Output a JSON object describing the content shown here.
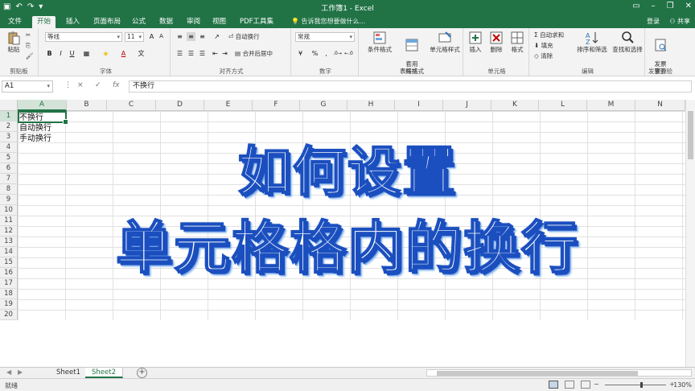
{
  "window": {
    "title": "工作簿1 - Excel",
    "login_label": "登录",
    "share_label": "共享"
  },
  "ribbon_tabs": [
    {
      "label": "文件"
    },
    {
      "label": "开始"
    },
    {
      "label": "插入"
    },
    {
      "label": "页面布局"
    },
    {
      "label": "公式"
    },
    {
      "label": "数据"
    },
    {
      "label": "审阅"
    },
    {
      "label": "视图"
    },
    {
      "label": "PDF工具集"
    }
  ],
  "tell_me": "告诉我您想要做什么...",
  "ribbon": {
    "clipboard": {
      "name": "剪贴板",
      "paste": "粘贴"
    },
    "font": {
      "name": "字体",
      "font_name": "等线",
      "font_size": "11",
      "bold": "B",
      "italic": "I",
      "underline": "U",
      "color_a": "A"
    },
    "alignment": {
      "name": "对齐方式",
      "wrap": "自动换行",
      "merge": "合并后居中"
    },
    "number": {
      "name": "数字",
      "format": "常规",
      "percent": "%",
      "comma": ","
    },
    "styles": {
      "name": "样式",
      "conditional": "条件格式",
      "table": "套用\n表格格式",
      "cell_styles": "单元格样式"
    },
    "cells": {
      "name": "单元格",
      "insert": "插入",
      "delete": "删除",
      "format": "格式"
    },
    "editing": {
      "name": "编辑",
      "autosum": "自动求和",
      "fill": "填充",
      "clear": "清除",
      "sort": "排序和筛选",
      "find": "查找和选择"
    },
    "send": {
      "name": "发票查验",
      "label": "发票\n查验"
    }
  },
  "formula_bar": {
    "name_box": "A1",
    "cancel": "×",
    "enter": "✓",
    "fx": "fx",
    "content": "不换行"
  },
  "columns": [
    "A",
    "B",
    "C",
    "D",
    "E",
    "F",
    "G",
    "H",
    "I",
    "J",
    "K",
    "L",
    "M",
    "N"
  ],
  "rows": [
    "1",
    "2",
    "3",
    "4",
    "5",
    "6",
    "7",
    "8",
    "9",
    "10",
    "11",
    "12",
    "13",
    "14",
    "15",
    "16",
    "17",
    "18",
    "19",
    "20"
  ],
  "cells": {
    "a1": "不换行",
    "a2": "自动换行",
    "a3": "手动换行"
  },
  "overlay": {
    "line1": "如何设置",
    "line2": "单元格格内的换行"
  },
  "sheets": [
    {
      "label": "Sheet1",
      "active": false
    },
    {
      "label": "Sheet2",
      "active": true
    }
  ],
  "add_sheet": "+",
  "status": {
    "ready": "就绪",
    "zoom": "130%",
    "zoom_minus": "−",
    "zoom_plus": "+"
  },
  "colors": {
    "brand": "#217346",
    "caption_stroke": "#1b4fbf"
  }
}
